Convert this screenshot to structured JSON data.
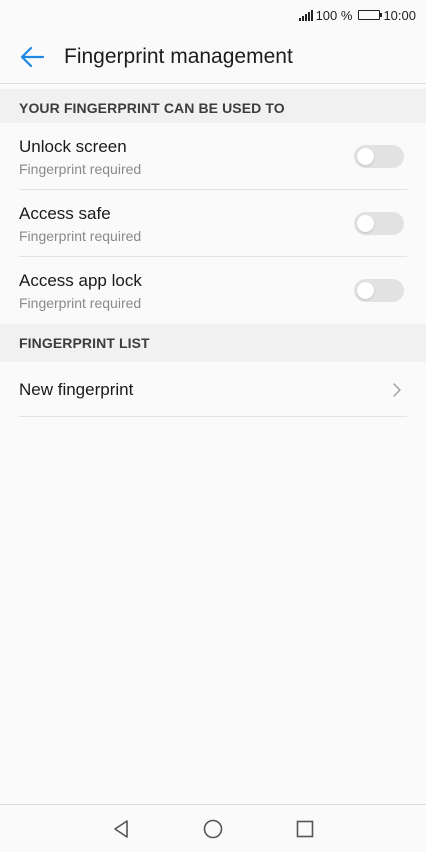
{
  "status_bar": {
    "battery_text": "100 %",
    "time": "10:00"
  },
  "header": {
    "title": "Fingerprint management",
    "back_icon": "arrow-left-icon",
    "accent_color": "#1e88e5"
  },
  "sections": {
    "usage": {
      "label": "YOUR FINGERPRINT CAN BE USED TO",
      "items": [
        {
          "title": "Unlock screen",
          "subtitle": "Fingerprint required",
          "enabled": false
        },
        {
          "title": "Access safe",
          "subtitle": "Fingerprint required",
          "enabled": false
        },
        {
          "title": "Access app lock",
          "subtitle": "Fingerprint required",
          "enabled": false
        }
      ]
    },
    "list": {
      "label": "FINGERPRINT LIST",
      "items": [
        {
          "title": "New fingerprint",
          "icon": "chevron-right-icon"
        }
      ]
    }
  },
  "nav_bar": {
    "back": "triangle-back-icon",
    "home": "circle-home-icon",
    "recents": "square-recents-icon"
  }
}
